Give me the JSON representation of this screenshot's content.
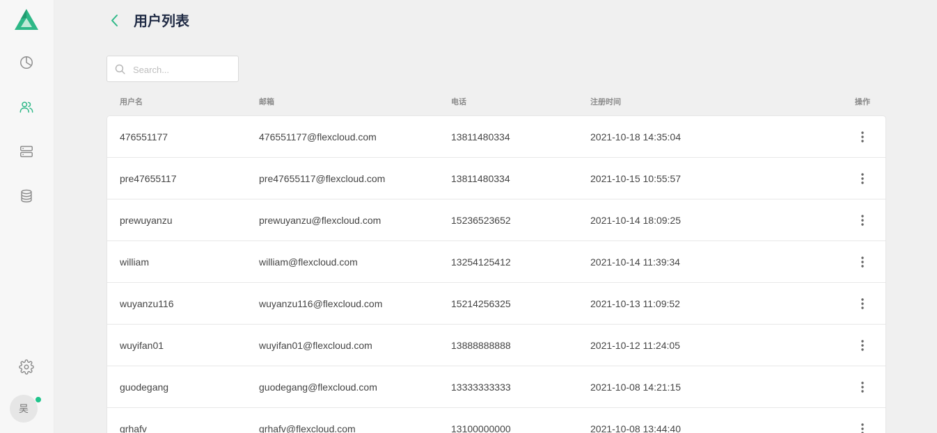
{
  "app": {
    "accent_color": "#2eb887",
    "page_title": "用户列表"
  },
  "sidebar": {
    "items": [
      {
        "name": "dashboard",
        "icon": "pie-chart-icon",
        "active": false
      },
      {
        "name": "users",
        "icon": "users-icon",
        "active": true
      },
      {
        "name": "servers",
        "icon": "server-icon",
        "active": false
      },
      {
        "name": "database",
        "icon": "database-icon",
        "active": false
      }
    ],
    "settings_icon": "gear-icon",
    "avatar_text": "吴",
    "online_color": "#1fc48b"
  },
  "search": {
    "placeholder": "Search...",
    "value": ""
  },
  "table": {
    "columns": {
      "username": "用户名",
      "email": "邮箱",
      "phone": "电话",
      "registered": "注册时间",
      "actions": "操作"
    },
    "rows": [
      {
        "username": "476551177",
        "email": "476551177@flexcloud.com",
        "phone": "13811480334",
        "registered": "2021-10-18 14:35:04"
      },
      {
        "username": "pre47655117",
        "email": "pre47655117@flexcloud.com",
        "phone": "13811480334",
        "registered": "2021-10-15 10:55:57"
      },
      {
        "username": "prewuyanzu",
        "email": "prewuyanzu@flexcloud.com",
        "phone": "15236523652",
        "registered": "2021-10-14 18:09:25"
      },
      {
        "username": "william",
        "email": "william@flexcloud.com",
        "phone": "13254125412",
        "registered": "2021-10-14 11:39:34"
      },
      {
        "username": "wuyanzu116",
        "email": "wuyanzu116@flexcloud.com",
        "phone": "15214256325",
        "registered": "2021-10-13 11:09:52"
      },
      {
        "username": "wuyifan01",
        "email": "wuyifan01@flexcloud.com",
        "phone": "13888888888",
        "registered": "2021-10-12 11:24:05"
      },
      {
        "username": "guodegang",
        "email": "guodegang@flexcloud.com",
        "phone": "13333333333",
        "registered": "2021-10-08 14:21:15"
      },
      {
        "username": "grhafv",
        "email": "grhafv@flexcloud.com",
        "phone": "13100000000",
        "registered": "2021-10-08 13:44:40"
      }
    ]
  }
}
